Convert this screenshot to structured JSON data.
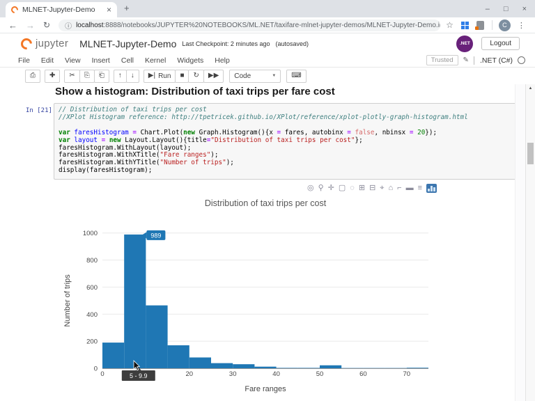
{
  "browser": {
    "tab_title": "MLNET-Jupyter-Demo",
    "close_tab_icon": "×",
    "new_tab_button": "+",
    "window": {
      "minimize": "–",
      "maximize": "□",
      "close": "×"
    },
    "nav": {
      "back": "←",
      "forward": "→",
      "reload": "↻"
    },
    "omnibox": {
      "info_icon": "ⓘ",
      "host": "localhost",
      "path": ":8888/notebooks/JUPYTER%20NOTEBOOKS/ML.NET/taxifare-mlnet-jupyter-demos/MLNET-Jupyter-Demo.ipynb",
      "bookmark_icon": "☆"
    },
    "avatar_letter": "C",
    "menu_icon": "⋮",
    "scrollbar": {
      "up_icon": "▲"
    }
  },
  "jupyter": {
    "logo_text": "jupyter",
    "notebook_title": "MLNET-Jupyter-Demo",
    "checkpoint": "Last Checkpoint: 2 minutes ago",
    "autosave": "(autosaved)",
    "dotnet_logo": ".NET",
    "logout": "Logout",
    "menu": [
      "File",
      "Edit",
      "View",
      "Insert",
      "Cell",
      "Kernel",
      "Widgets",
      "Help"
    ],
    "trusted": "Trusted",
    "pencil_icon": "✎",
    "kernel_name": ".NET (C#)"
  },
  "toolbar": {
    "buttons": [
      {
        "name": "save-button",
        "glyph": "⎙",
        "group": "a"
      },
      {
        "name": "add-cell-button",
        "glyph": "✚",
        "group": "b"
      },
      {
        "name": "cut-cell-button",
        "glyph": "✂",
        "group": "c"
      },
      {
        "name": "copy-cell-button",
        "glyph": "⎘",
        "group": "c"
      },
      {
        "name": "paste-cell-button",
        "glyph": "⎗",
        "group": "c"
      },
      {
        "name": "move-cell-up-button",
        "glyph": "↑",
        "group": "d"
      },
      {
        "name": "move-cell-down-button",
        "glyph": "↓",
        "group": "d"
      },
      {
        "name": "run-button",
        "glyph": "▶|",
        "label": "Run",
        "group": "e"
      },
      {
        "name": "interrupt-kernel-button",
        "glyph": "■",
        "group": "e"
      },
      {
        "name": "restart-kernel-button",
        "glyph": "↻",
        "group": "e"
      },
      {
        "name": "restart-run-all-button",
        "glyph": "▶▶",
        "group": "e"
      }
    ],
    "cell_type": "Code",
    "dropdown_caret": "▼",
    "keyboard_icon": "⌨"
  },
  "cell": {
    "heading": "Show a histogram: Distribution of taxi trips per fare cost",
    "prompt": "In [21]:",
    "code_lines": [
      [
        [
          "com",
          "// Distribution of taxi trips per cost"
        ]
      ],
      [
        [
          "com",
          "//XPlot Histogram reference: http://tpetricek.github.io/XPlot/reference/xplot-plotly-graph-histogram.html"
        ]
      ],
      [],
      [
        [
          "kw",
          "var"
        ],
        [
          "pl",
          " "
        ],
        [
          "def",
          "faresHistogram"
        ],
        [
          "pl",
          " "
        ],
        [
          "op",
          "="
        ],
        [
          "pl",
          " Chart.Plot("
        ],
        [
          "kw",
          "new"
        ],
        [
          "pl",
          " Graph.Histogram(){x "
        ],
        [
          "op",
          "="
        ],
        [
          "pl",
          " fares, autobinx "
        ],
        [
          "op",
          "="
        ],
        [
          "pl",
          " "
        ],
        [
          "atom",
          "false"
        ],
        [
          "pl",
          ", nbinsx "
        ],
        [
          "op",
          "="
        ],
        [
          "pl",
          " "
        ],
        [
          "num",
          "20"
        ],
        [
          "pl",
          "});"
        ]
      ],
      [
        [
          "kw",
          "var"
        ],
        [
          "pl",
          " "
        ],
        [
          "def",
          "layout"
        ],
        [
          "pl",
          " "
        ],
        [
          "op",
          "="
        ],
        [
          "pl",
          " "
        ],
        [
          "kw",
          "new"
        ],
        [
          "pl",
          " Layout.Layout(){title"
        ],
        [
          "op",
          "="
        ],
        [
          "str",
          "\"Distribution of taxi trips per cost\""
        ],
        [
          "pl",
          "};"
        ]
      ],
      [
        [
          "pl",
          "faresHistogram.WithLayout(layout);"
        ]
      ],
      [
        [
          "pl",
          "faresHistogram.WithXTitle("
        ],
        [
          "str",
          "\"Fare ranges\""
        ],
        [
          "pl",
          ");"
        ]
      ],
      [
        [
          "pl",
          "faresHistogram.WithYTitle("
        ],
        [
          "str",
          "\"Number of trips\""
        ],
        [
          "pl",
          ");"
        ]
      ],
      [
        [
          "pl",
          "display(faresHistogram);"
        ]
      ]
    ]
  },
  "modebar": [
    {
      "name": "camera-icon",
      "glyph": "◎"
    },
    {
      "name": "zoom-icon",
      "glyph": "⚲"
    },
    {
      "name": "pan-icon",
      "glyph": "✛"
    },
    {
      "name": "box-select-icon",
      "glyph": "▢"
    },
    {
      "name": "lasso-select-icon",
      "glyph": "◌"
    },
    {
      "name": "zoom-in-icon",
      "glyph": "⊞"
    },
    {
      "name": "zoom-out-icon",
      "glyph": "⊟"
    },
    {
      "name": "autoscale-icon",
      "glyph": "⌖"
    },
    {
      "name": "reset-axes-icon",
      "glyph": "⌂"
    },
    {
      "name": "spike-lines-icon",
      "glyph": "⌐"
    },
    {
      "name": "hover-closest-icon",
      "glyph": "▬"
    },
    {
      "name": "hover-compare-icon",
      "glyph": "≡"
    }
  ],
  "chart_data": {
    "type": "bar",
    "subtype": "histogram",
    "title": "Distribution of taxi trips per cost",
    "xlabel": "Fare ranges",
    "ylabel": "Number of trips",
    "bin_start": 0,
    "bin_width": 5,
    "counts": [
      190,
      989,
      465,
      170,
      80,
      38,
      30,
      12,
      3,
      3,
      22,
      2,
      2,
      2,
      4
    ],
    "xlim": [
      0,
      75
    ],
    "ylim": [
      0,
      1050
    ],
    "xticks": [
      0,
      10,
      20,
      30,
      40,
      50,
      60,
      70
    ],
    "yticks": [
      0,
      200,
      400,
      600,
      800,
      1000
    ],
    "grid": true,
    "legend": false,
    "bar_color": "#1f77b4",
    "tooltip_color": "#3d3d3d",
    "hover": {
      "bin_index": 1,
      "value_label": "989",
      "range_label": "5 - 9.9"
    }
  }
}
